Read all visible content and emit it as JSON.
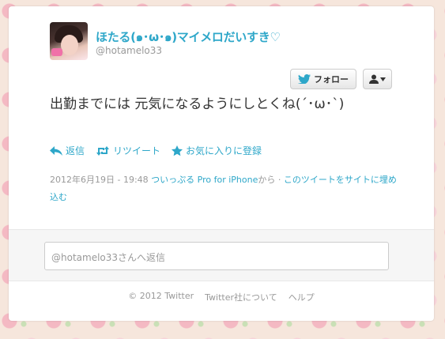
{
  "profile": {
    "display_name": "ほたる(๑･ω･๑)マイメロだいすき♡",
    "screen_name": "@hotamelo33"
  },
  "buttons": {
    "follow": "フォロー"
  },
  "tweet": {
    "text": "出勤までには 元気になるようにしとくね(´･ω･`)",
    "actions": {
      "reply": "返信",
      "retweet": "リツイート",
      "favorite": "お気に入りに登録"
    },
    "timestamp": "2012年6月19日 - 19:48",
    "via": "ついっぷる Pro for iPhone",
    "via_suffix": "から",
    "separator": " · ",
    "embed": "このツイートをサイトに埋め込む"
  },
  "reply": {
    "placeholder": "@hotamelo33さんへ返信"
  },
  "footer": {
    "copyright": "© 2012 Twitter",
    "about": "Twitter社について",
    "help": "ヘルプ"
  },
  "colors": {
    "link": "#2ea7c9",
    "muted": "#999999",
    "text": "#333333"
  }
}
